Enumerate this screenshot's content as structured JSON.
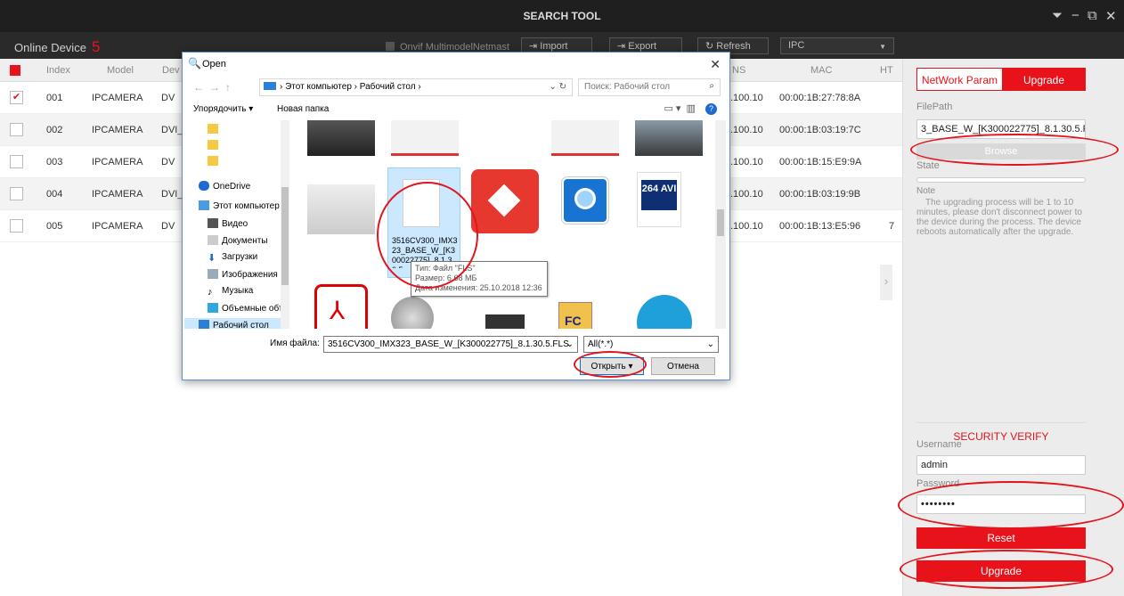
{
  "app": {
    "title": "SEARCH TOOL",
    "window_controls": [
      "⏷",
      "−",
      "⧉",
      "✕"
    ]
  },
  "toolbar": {
    "online_label": "Online Device",
    "online_count": "5",
    "onvif_label": "Onvif MultimodelNetmast",
    "import_label": "Import",
    "export_label": "Export",
    "refresh_label": "Refresh",
    "device_type": "IPC"
  },
  "table": {
    "headers": [
      "Index",
      "Model",
      "Dev",
      "NS",
      "MAC",
      "HT"
    ],
    "rows": [
      {
        "index": "001",
        "model": "IPCAMERA",
        "dev": "DV",
        "ip": ".100.10",
        "mac": "00:00:1B:27:78:8A",
        "checked": true
      },
      {
        "index": "002",
        "model": "IPCAMERA",
        "dev": "DVI_",
        "ip": ".100.10",
        "mac": "00:00:1B:03:19:7C",
        "checked": false
      },
      {
        "index": "003",
        "model": "IPCAMERA",
        "dev": "DV",
        "ip": ".100.10",
        "mac": "00:00:1B:15:E9:9A",
        "checked": false
      },
      {
        "index": "004",
        "model": "IPCAMERA",
        "dev": "DVI_",
        "ip": ".100.10",
        "mac": "00:00:1B:03:19:9B",
        "checked": false
      },
      {
        "index": "005",
        "model": "IPCAMERA",
        "dev": "DV",
        "ip": ".100.10",
        "mac": "00:00:1B:13:E5:96",
        "checked": false,
        "extra": "7"
      }
    ]
  },
  "panel": {
    "tab_network": "NetWork Param",
    "tab_upgrade": "Upgrade",
    "filepath_label": "FilePath",
    "filepath_value": "3_BASE_W_[K300022775]_8.1.30.5.FLS",
    "browse_label": "Browse",
    "state_label": "State",
    "note_label": "Note",
    "note_text": "The upgrading process will be 1 to 10 minutes, please don't disconnect power to the device during the process. The device reboots automatically after the upgrade.",
    "security_title": "SECURITY VERIFY",
    "username_label": "Username",
    "username_value": "admin",
    "password_label": "Password",
    "password_value": "••••••••",
    "reset_label": "Reset",
    "upgrade_label": "Upgrade"
  },
  "dialog": {
    "title": "Open",
    "breadcrumb": "›  Этот компьютер  ›  Рабочий стол  ›",
    "search_placeholder": "Поиск: Рабочий стол",
    "organize_label": "Упорядочить ▾",
    "new_folder_label": "Новая папка",
    "nav_items": [
      "OneDrive",
      "Этот компьютер",
      "Видео",
      "Документы",
      "Загрузки",
      "Изображения",
      "Музыка",
      "Объемные объ",
      "Рабочий стол"
    ],
    "selected_file_caption": "3516CV300_IMX323_BASE_W_[K300022775]_8.1.30.5",
    "tooltip_type": "Тип: Файл \"FLS\"",
    "tooltip_size": "Размер: 6,68 МБ",
    "tooltip_date": "Дата изменения: 25.10.2018 12:36",
    "filename_label": "Имя файла:",
    "filename_value": "3516CV300_IMX323_BASE_W_[K300022775]_8.1.30.5.FLS",
    "filetype_value": "All(*.*)",
    "open_label": "Открыть",
    "cancel_label": "Отмена",
    "avi_badge": "264 AVI",
    "fc_badge": "FC"
  },
  "colors": {
    "accent": "#e8131a",
    "titlebar": "#1f1f1f"
  }
}
